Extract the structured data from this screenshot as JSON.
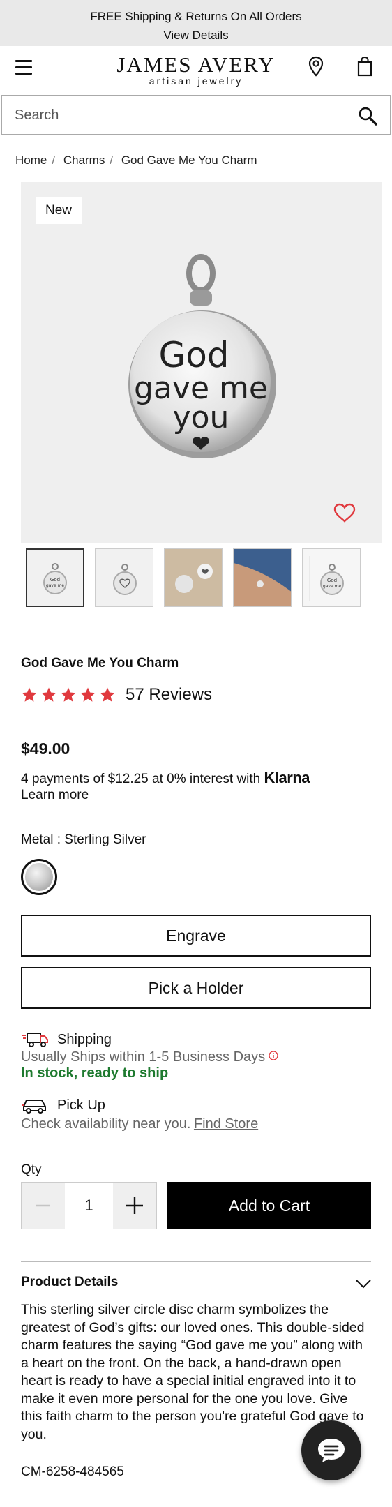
{
  "promo": {
    "text": "FREE Shipping & Returns On All Orders",
    "link": "View Details"
  },
  "header": {
    "brand": "JAMES AVERY",
    "tagline": "artisan jewelry"
  },
  "search": {
    "placeholder": "Search"
  },
  "breadcrumb": [
    "Home",
    "Charms",
    "God Gave Me You Charm"
  ],
  "gallery": {
    "badge": "New",
    "charm_text": [
      "God",
      "gave me",
      "you"
    ],
    "thumbnail_count": 5
  },
  "product": {
    "title": "God Gave Me You Charm",
    "rating_stars": 5,
    "reviews": "57 Reviews",
    "price": "$49.00",
    "klarna_text": "4 payments of $12.25 at 0% interest with",
    "klarna_brand": "Klarna",
    "klarna_learn": "Learn more",
    "metal_label": "Metal : Sterling Silver"
  },
  "actions": {
    "engrave": "Engrave",
    "holder": "Pick a Holder",
    "add_to_cart": "Add to Cart"
  },
  "shipping": {
    "title": "Shipping",
    "sub": "Usually Ships within 1-5 Business Days",
    "stock": "In stock, ready to ship",
    "pickup_title": "Pick Up",
    "pickup_text": "Check availability near you.",
    "find_store": "Find Store"
  },
  "qty": {
    "label": "Qty",
    "value": "1"
  },
  "details": {
    "title": "Product Details",
    "description": "This sterling silver circle disc charm symbolizes the greatest of God’s gifts: our loved ones. This double-sided charm features the saying “God gave me you” along with a heart on the front. On the back, a hand-drawn open heart is ready to have a special initial engraved into it to make it even more personal for the one you love. Give this faith charm to the person you're grateful God gave to you.",
    "sku": "CM-6258-484565"
  },
  "colors": {
    "accent_red": "#e0393e",
    "stock_green": "#1e7a2f"
  }
}
